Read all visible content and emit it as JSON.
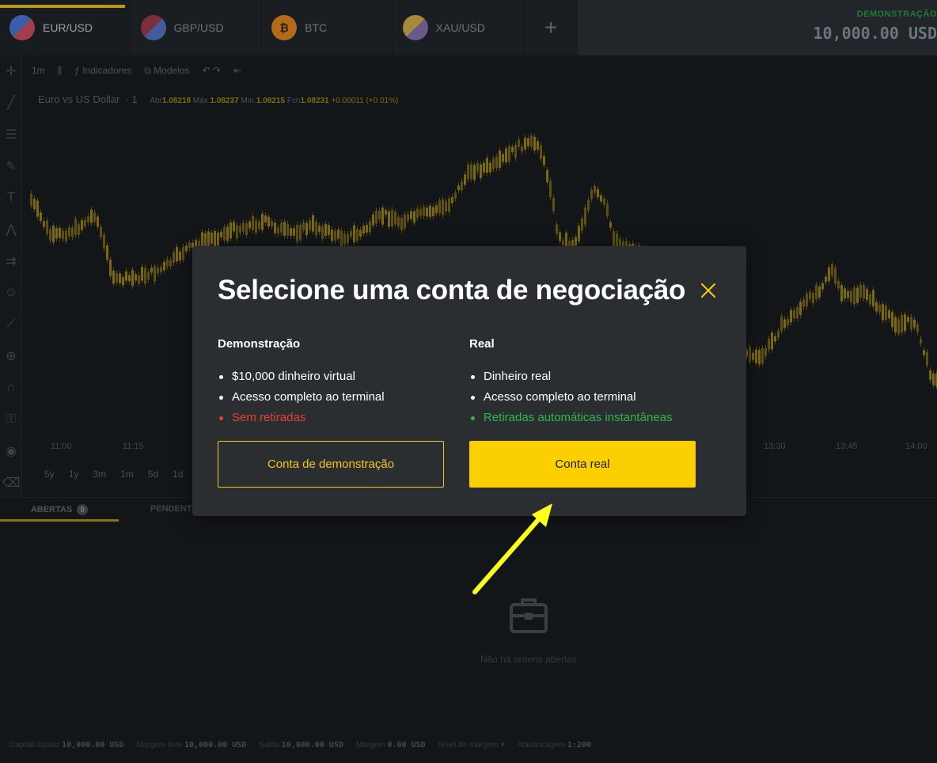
{
  "tabs": [
    {
      "label": "EUR/USD",
      "icon": "eur-usd-flag-icon",
      "active": true
    },
    {
      "label": "GBP/USD",
      "icon": "gbp-usd-flag-icon",
      "active": false
    },
    {
      "label": "BTC",
      "icon": "bitcoin-icon",
      "coin_glyph": "₿",
      "active": false
    },
    {
      "label": "XAU/USD",
      "icon": "xau-usd-icon",
      "active": false
    }
  ],
  "header": {
    "account_mode": "DEMONSTRAÇÃO",
    "balance": "10,000.00 USD"
  },
  "chart": {
    "toolbar": {
      "interval": "1m",
      "indicators": "Indicadores",
      "templates": "Modelos"
    },
    "legend": {
      "symbol": "Euro vs US Dollar",
      "interval": "1",
      "open": "1.08218",
      "high": "1.08237",
      "low": "1.08215",
      "close": "1.08231",
      "change": "+0.00011 (+0.01%)"
    },
    "time_labels": [
      "11:00",
      "11:15",
      "13:30",
      "13:45",
      "14:00"
    ],
    "ranges": [
      "5y",
      "1y",
      "3m",
      "1m",
      "5d",
      "1d"
    ]
  },
  "bottom": {
    "open_tab": "ABERTAS",
    "open_count": "0",
    "pending_tab": "PENDENTES",
    "empty_text": "Não há ordens abertas"
  },
  "footer": [
    {
      "label": "Capital líquido",
      "value": "10,000.00 USD"
    },
    {
      "label": "Margem livre",
      "value": "10,000.00 USD"
    },
    {
      "label": "Saldo",
      "value": "10,000.00 USD"
    },
    {
      "label": "Margem",
      "value": "0.00 USD"
    },
    {
      "label": "Nível de margem",
      "value": ""
    },
    {
      "label": "Alavancagem",
      "value": "1:200"
    }
  ],
  "modal": {
    "title": "Selecione uma conta de negociação",
    "demo": {
      "title": "Demonstração",
      "items": [
        "$10,000 dinheiro virtual",
        "Acesso completo ao terminal"
      ],
      "negative": "Sem retiradas",
      "button": "Conta de demonstração"
    },
    "real": {
      "title": "Real",
      "items": [
        "Dinheiro real",
        "Acesso completo ao terminal"
      ],
      "positive": "Retiradas automáticas instantâneas",
      "button": "Conta real"
    }
  },
  "colors": {
    "accent": "#fccf00",
    "negative": "#e5412f",
    "positive": "#2db84f",
    "modal_bg": "#2b2e31",
    "annotation_arrow": "#ffff1a"
  }
}
